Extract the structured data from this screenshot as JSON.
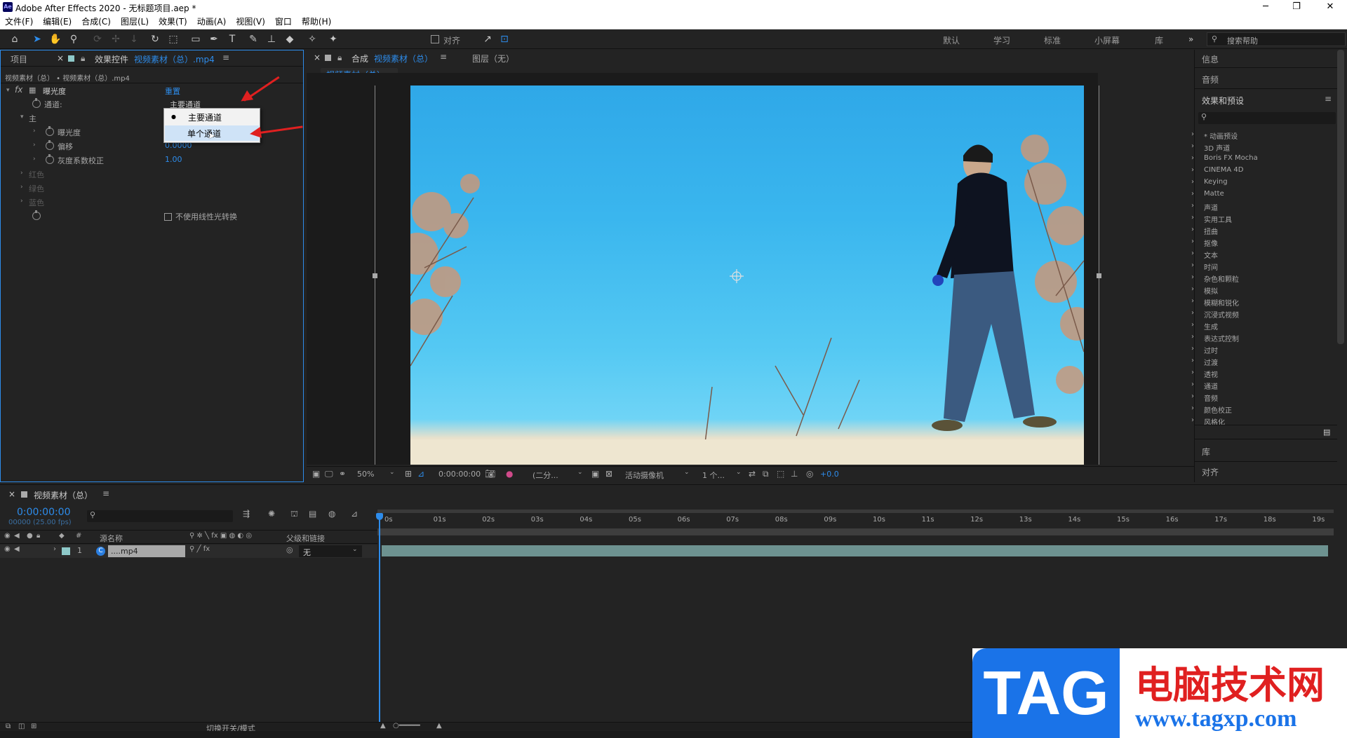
{
  "window": {
    "title": "Adobe After Effects 2020 - 无标题项目.aep *",
    "logo": "Ae",
    "controls": [
      "─",
      "❐",
      "✕"
    ]
  },
  "menu": [
    "文件(F)",
    "编辑(E)",
    "合成(C)",
    "图层(L)",
    "效果(T)",
    "动画(A)",
    "视图(V)",
    "窗口",
    "帮助(H)"
  ],
  "toolbar": {
    "align_label": "对齐",
    "workspaces": [
      "默认",
      "学习",
      "标准",
      "小屏幕",
      "库"
    ],
    "more": "»",
    "search_placeholder": "搜索帮助"
  },
  "left_panel": {
    "tab_project": "项目",
    "tab_effects_prefix": "效果控件",
    "tab_effects_file": "视频素材（总）.mp4",
    "breadcrumb": "视频素材（总） • 视频素材（总）.mp4",
    "effect_name": "曝光度",
    "reset": "重置",
    "channel_label": "通道:",
    "channel_value": "主要通道",
    "master_label": "主",
    "props": [
      {
        "name": "曝光度",
        "value": ""
      },
      {
        "name": "偏移",
        "value": "0.0000"
      },
      {
        "name": "灰度系数校正",
        "value": "1.00"
      }
    ],
    "disabled": [
      "红色",
      "绿色",
      "蓝色"
    ],
    "checkbox_label": "不使用线性光转换"
  },
  "dropdown": {
    "options": [
      "主要通道",
      "单个通道"
    ],
    "selected": 0,
    "hover": 1
  },
  "comp_panel": {
    "tab_prefix": "合成",
    "tab_name": "视频素材（总）",
    "layer_tab": "图层（无）",
    "subtab": "视频素材（总）",
    "zoom": "50%",
    "timecode": "0:00:00:00",
    "resolution": "(二分...",
    "camera": "活动摄像机",
    "views": "1 个...",
    "exposure": "+0.0"
  },
  "right_panel": {
    "info": "信息",
    "audio": "音频",
    "effects_presets": "效果和预设",
    "effects": [
      "* 动画预设",
      "3D 声道",
      "Boris FX Mocha",
      "CINEMA 4D",
      "Keying",
      "Matte",
      "声道",
      "实用工具",
      "扭曲",
      "抠像",
      "文本",
      "时间",
      "杂色和颗粒",
      "模拟",
      "模糊和锐化",
      "沉浸式视频",
      "生成",
      "表达式控制",
      "过时",
      "过渡",
      "透视",
      "通道",
      "音频",
      "颜色校正",
      "风格化"
    ],
    "library": "库",
    "align": "对齐"
  },
  "timeline": {
    "comp_name": "视频素材（总）",
    "timecode": "0:00:00:00",
    "fps": "00000 (25.00 fps)",
    "col_source": "源名称",
    "col_parent": "父级和链接",
    "layer_num": "1",
    "layer_name": "....mp4",
    "parent_value": "无",
    "ticks": [
      "0s",
      "01s",
      "02s",
      "03s",
      "04s",
      "05s",
      "06s",
      "07s",
      "08s",
      "09s",
      "10s",
      "11s",
      "12s",
      "13s",
      "14s",
      "15s",
      "16s",
      "17s",
      "18s",
      "19s"
    ],
    "toggle_label": "切换开关/模式"
  },
  "watermark": {
    "tag": "TAG",
    "cn": "电脑技术网",
    "url": "www.tagxp.com"
  },
  "colors": {
    "accent": "#2d8ceb",
    "bg": "#232323",
    "arrow": "#e02020"
  }
}
